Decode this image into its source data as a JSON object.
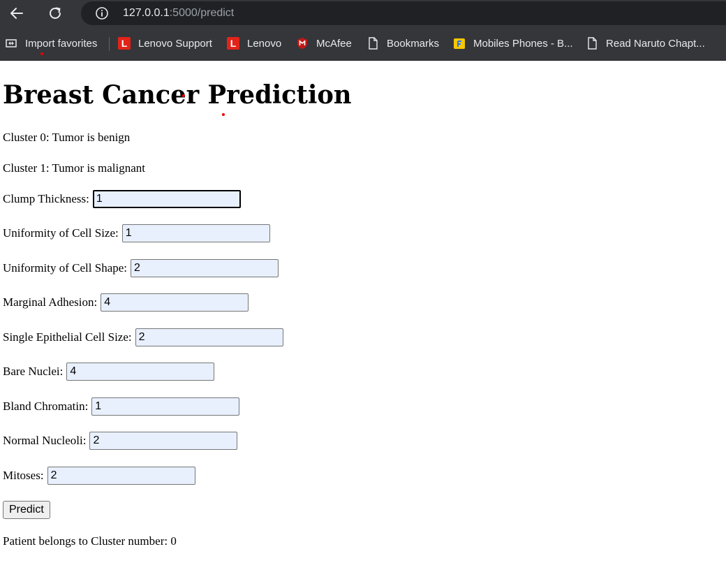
{
  "browser": {
    "url_host": "127.0.0.1",
    "url_rest": ":5000/predict",
    "bookmarks": [
      {
        "label": "Import favorites",
        "icon": "import-icon"
      },
      {
        "label": "Lenovo Support",
        "icon": "lenovo-icon"
      },
      {
        "label": "Lenovo",
        "icon": "lenovo-icon"
      },
      {
        "label": "McAfee",
        "icon": "mcafee-icon"
      },
      {
        "label": "Bookmarks",
        "icon": "page-icon"
      },
      {
        "label": "Mobiles Phones - B...",
        "icon": "flipkart-icon"
      },
      {
        "label": "Read Naruto Chapt...",
        "icon": "page-icon"
      }
    ]
  },
  "page": {
    "title": "Breast Cancer Prediction",
    "cluster_info": [
      "Cluster 0: Tumor is benign",
      "Cluster 1: Tumor is malignant"
    ],
    "fields": [
      {
        "label": "Clump Thickness:",
        "value": "1"
      },
      {
        "label": "Uniformity of Cell Size:",
        "value": "1"
      },
      {
        "label": "Uniformity of Cell Shape:",
        "value": "2"
      },
      {
        "label": "Marginal Adhesion:",
        "value": "4"
      },
      {
        "label": "Single Epithelial Cell Size:",
        "value": "2"
      },
      {
        "label": "Bare Nuclei:",
        "value": "4"
      },
      {
        "label": "Bland Chromatin:",
        "value": "1"
      },
      {
        "label": "Normal Nucleoli:",
        "value": "2"
      },
      {
        "label": "Mitoses:",
        "value": "2"
      }
    ],
    "submit_label": "Predict",
    "result": "Patient belongs to Cluster number: 0"
  },
  "colors": {
    "chrome": "#35363a",
    "address_bar": "#202124",
    "input_fill": "#e8f0fe",
    "lenovo_red": "#e2231a"
  }
}
